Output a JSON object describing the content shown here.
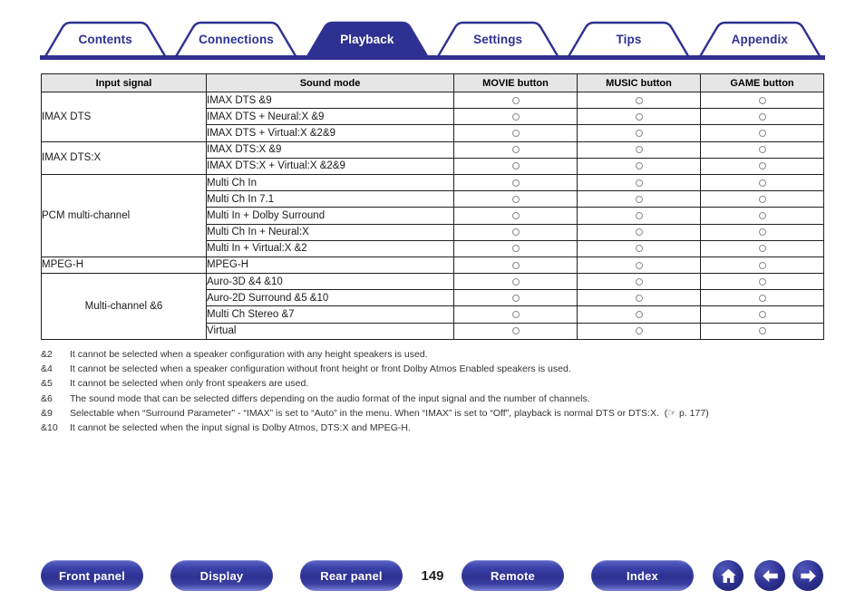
{
  "nav_tabs": [
    {
      "label": "Contents",
      "active": false
    },
    {
      "label": "Connections",
      "active": false
    },
    {
      "label": "Playback",
      "active": true
    },
    {
      "label": "Settings",
      "active": false
    },
    {
      "label": "Tips",
      "active": false
    },
    {
      "label": "Appendix",
      "active": false
    }
  ],
  "table": {
    "columns": [
      "Input signal",
      "Sound mode",
      "MOVIE button",
      "MUSIC button",
      "GAME button"
    ],
    "groups": [
      {
        "input_signal": "IMAX DTS",
        "label_align": "left",
        "rows": [
          {
            "sound_mode": "IMAX DTS &9",
            "movie": "○",
            "music": "○",
            "game": "○"
          },
          {
            "sound_mode": "IMAX DTS + Neural:X &9",
            "movie": "○",
            "music": "○",
            "game": "○"
          },
          {
            "sound_mode": "IMAX DTS + Virtual:X &2&9",
            "movie": "○",
            "music": "○",
            "game": "○"
          }
        ]
      },
      {
        "input_signal": "IMAX DTS:X",
        "label_align": "left",
        "rows": [
          {
            "sound_mode": "IMAX DTS:X &9",
            "movie": "○",
            "music": "○",
            "game": "○"
          },
          {
            "sound_mode": "IMAX DTS:X + Virtual:X &2&9",
            "movie": "○",
            "music": "○",
            "game": "○"
          }
        ]
      },
      {
        "input_signal": "PCM multi-channel",
        "label_align": "left",
        "rows": [
          {
            "sound_mode": "Multi Ch In",
            "movie": "○",
            "music": "○",
            "game": "○"
          },
          {
            "sound_mode": "Multi Ch In 7.1",
            "movie": "○",
            "music": "○",
            "game": "○"
          },
          {
            "sound_mode": "Multi In + Dolby Surround",
            "movie": "○",
            "music": "○",
            "game": "○"
          },
          {
            "sound_mode": "Multi Ch In + Neural:X",
            "movie": "○",
            "music": "○",
            "game": "○"
          },
          {
            "sound_mode": "Multi In + Virtual:X &2",
            "movie": "○",
            "music": "○",
            "game": "○"
          }
        ]
      },
      {
        "input_signal": "MPEG-H",
        "label_align": "left",
        "rows": [
          {
            "sound_mode": "MPEG-H",
            "movie": "○",
            "music": "○",
            "game": "○"
          }
        ]
      },
      {
        "input_signal": "Multi-channel &6",
        "label_align": "center",
        "rows": [
          {
            "sound_mode": "Auro-3D &4 &10",
            "movie": "○",
            "music": "○",
            "game": "○"
          },
          {
            "sound_mode": "Auro-2D Surround &5 &10",
            "movie": "○",
            "music": "○",
            "game": "○"
          },
          {
            "sound_mode": "Multi Ch Stereo &7",
            "movie": "○",
            "music": "○",
            "game": "○"
          },
          {
            "sound_mode": "Virtual",
            "movie": "○",
            "music": "○",
            "game": "○"
          }
        ]
      }
    ]
  },
  "footnotes": [
    {
      "marker": "&2",
      "text": "It cannot be selected when a speaker configuration with any height speakers is used."
    },
    {
      "marker": "&4",
      "text": "It cannot be selected when a speaker configuration without front height or front Dolby Atmos Enabled speakers is used."
    },
    {
      "marker": "&5",
      "text": "It cannot be selected when only front speakers are used."
    },
    {
      "marker": "&6",
      "text": "The sound mode that can be selected differs depending on the audio format of the input signal and the number of channels."
    },
    {
      "marker": "&9",
      "text": "Selectable when “Surround Parameter” - “IMAX” is set to “Auto” in the menu. When “IMAX” is set to “Off”, playback is normal DTS or DTS:X.",
      "link_prefix": "(",
      "link_icon": "☞",
      "link_text": " p. 177)"
    },
    {
      "marker": "&10",
      "text": "It cannot be selected when the input signal is Dolby Atmos, DTS:X and MPEG-H."
    }
  ],
  "bottom_bar": {
    "buttons": [
      {
        "label": "Front panel"
      },
      {
        "label": "Display"
      },
      {
        "label": "Rear panel"
      },
      {
        "label": "Remote"
      },
      {
        "label": "Index"
      }
    ],
    "page_number": "149",
    "icons": [
      {
        "name": "home-icon"
      },
      {
        "name": "arrow-left-icon"
      },
      {
        "name": "arrow-right-icon"
      }
    ]
  },
  "colors": {
    "brand_navy": "#2e3191",
    "header_bg": "#e6e6e6",
    "border": "#231f20",
    "circle_gray": "#8a8a8a"
  }
}
